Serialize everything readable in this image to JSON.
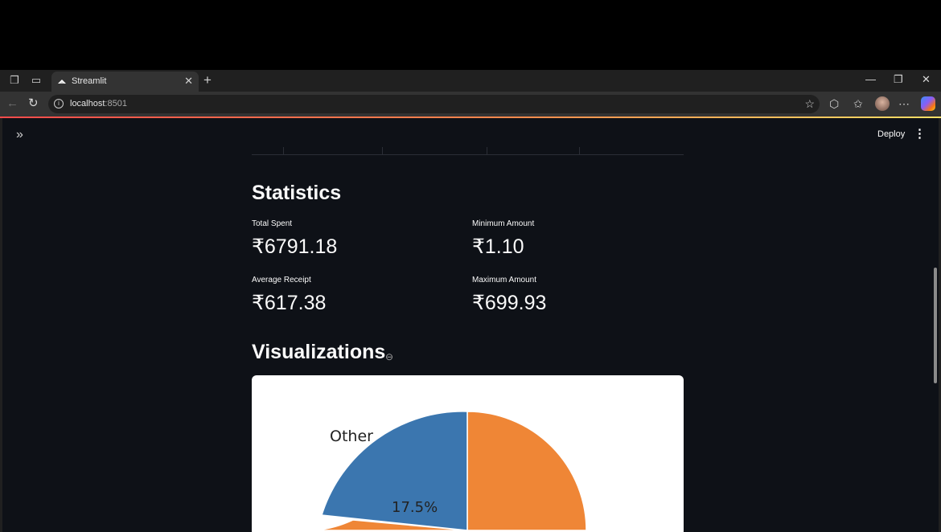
{
  "browser": {
    "tab_title": "Streamlit",
    "url_host": "localhost",
    "url_port": ":8501"
  },
  "app": {
    "deploy_label": "Deploy"
  },
  "statistics": {
    "heading": "Statistics",
    "metrics": [
      {
        "label": "Total Spent",
        "value": "₹6791.18"
      },
      {
        "label": "Minimum Amount",
        "value": "₹1.10"
      },
      {
        "label": "Average Receipt",
        "value": "₹617.38"
      },
      {
        "label": "Maximum Amount",
        "value": "₹699.93"
      }
    ]
  },
  "visualizations": {
    "heading": "Visualizations"
  },
  "chart_data": {
    "type": "pie",
    "slices": [
      {
        "label": "Other",
        "pct_label": "17.5%",
        "value": 17.5,
        "color": "#3b76af"
      }
    ],
    "colors": {
      "other": "#3b76af",
      "orange": "#ef8636"
    }
  }
}
